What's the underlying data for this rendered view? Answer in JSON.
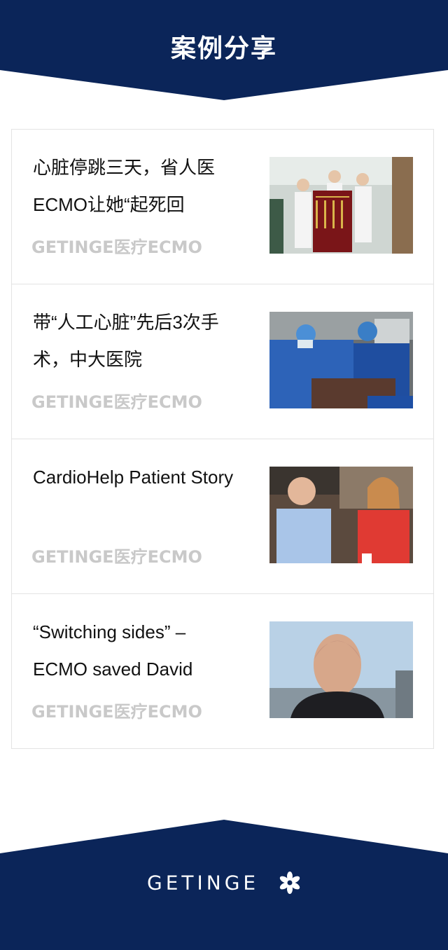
{
  "header": {
    "title": "案例分享"
  },
  "cards": [
    {
      "title": "心脏停跳三天，省人医ECMO让她“起死回",
      "source": "GETINGE医疗ECMO",
      "image": "nurses-holding-banner-photo"
    },
    {
      "title": "带“人工心脏”先后3次手术，中大医院",
      "source": "GETINGE医疗ECMO",
      "image": "surgeons-operating-photo"
    },
    {
      "title": "CardioHelp Patient Story",
      "source": "GETINGE医疗ECMO",
      "image": "man-and-woman-smiling-photo"
    },
    {
      "title": "“Switching sides” – ECMO saved David",
      "source": "GETINGE医疗ECMO",
      "image": "bald-man-portrait-photo"
    }
  ],
  "footer": {
    "logo_text": "GETINGE",
    "logo_icon": "getinge-star-icon"
  },
  "colors": {
    "navy": "#0b2559",
    "source_gray": "#c9c9c9",
    "border": "#e3e3e3"
  }
}
